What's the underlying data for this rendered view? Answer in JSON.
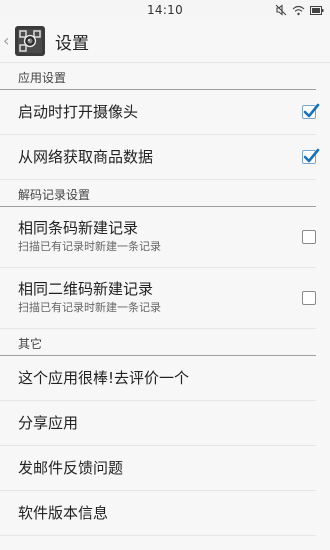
{
  "status_bar": {
    "time": "14:10"
  },
  "app_bar": {
    "back_glyph": "‹",
    "title": "设置",
    "icon": "qr-scanner-app-icon"
  },
  "sections": [
    {
      "header": "应用设置",
      "items": [
        {
          "title": "启动时打开摄像头",
          "checked": true
        },
        {
          "title": "从网络获取商品数据",
          "checked": true
        }
      ]
    },
    {
      "header": "解码记录设置",
      "items": [
        {
          "title": "相同条码新建记录",
          "summary": "扫描已有记录时新建一条记录",
          "checked": false
        },
        {
          "title": "相同二维码新建记录",
          "summary": "扫描已有记录时新建一条记录",
          "checked": false
        }
      ]
    },
    {
      "header": "其它",
      "items": [
        {
          "title": "这个应用很棒!去评价一个"
        },
        {
          "title": "分享应用"
        },
        {
          "title": "发邮件反馈问题"
        },
        {
          "title": "软件版本信息"
        }
      ]
    }
  ],
  "colors": {
    "check_accent": "#1a73b8",
    "divider": "#9e9e9e"
  }
}
